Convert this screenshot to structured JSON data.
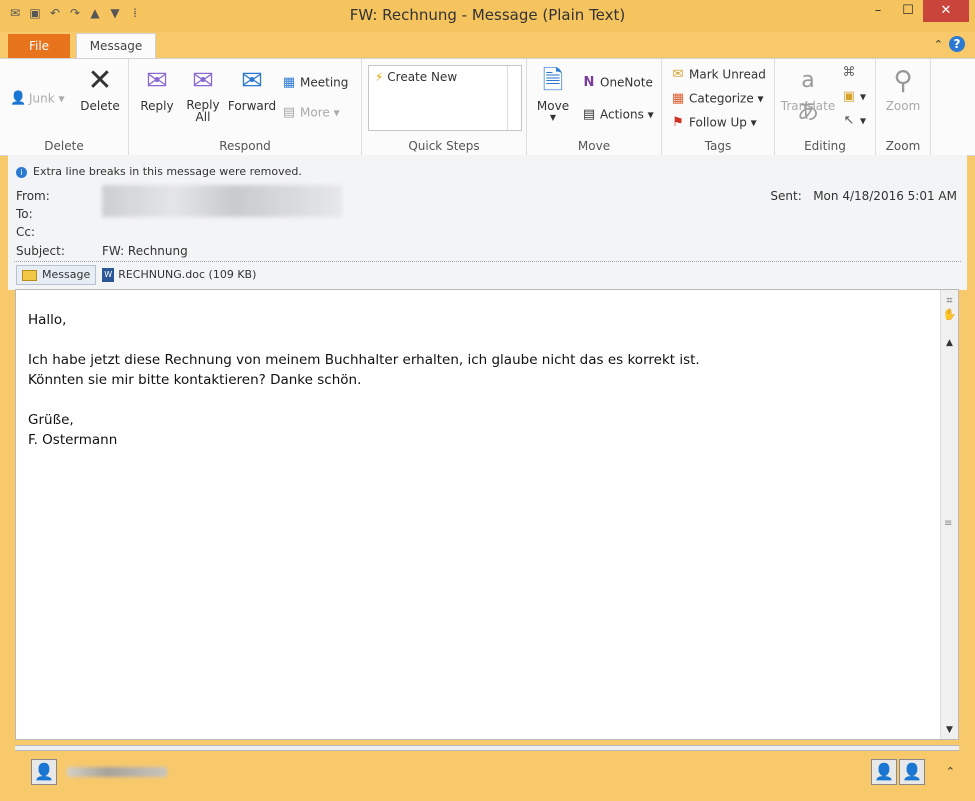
{
  "window": {
    "title": "FW: Rechnung  -  Message (Plain Text)",
    "controls": {
      "minimize": "–",
      "maximize": "☐",
      "close": "✕"
    }
  },
  "quick_access": [
    "mail-icon",
    "save-icon",
    "undo-icon",
    "redo-icon",
    "up-icon",
    "down-icon",
    "customize-icon"
  ],
  "tabs": {
    "file": "File",
    "message": "Message"
  },
  "ribbon": {
    "delete_group": {
      "label": "Delete",
      "junk": "Junk",
      "delete": "Delete"
    },
    "respond_group": {
      "label": "Respond",
      "reply": "Reply",
      "reply_all_1": "Reply",
      "reply_all_2": "All",
      "forward": "Forward",
      "meeting": "Meeting",
      "more": "More"
    },
    "quicksteps_group": {
      "label": "Quick Steps",
      "create_new": "Create New"
    },
    "move_group": {
      "label": "Move",
      "move": "Move",
      "onenote": "OneNote",
      "actions": "Actions"
    },
    "tags_group": {
      "label": "Tags",
      "mark_unread": "Mark Unread",
      "categorize": "Categorize",
      "follow_up": "Follow Up"
    },
    "editing_group": {
      "label": "Editing",
      "translate": "Translate"
    },
    "zoom_group": {
      "label": "Zoom",
      "zoom": "Zoom"
    }
  },
  "header": {
    "info": "Extra line breaks in this message were removed.",
    "from_label": "From:",
    "to_label": "To:",
    "cc_label": "Cc:",
    "subject_label": "Subject:",
    "subject": "FW: Rechnung",
    "sent_label": "Sent:",
    "sent": "Mon 4/18/2016 5:01 AM",
    "message_tab": "Message",
    "attachment": "RECHNUNG.doc (109 KB)"
  },
  "body": {
    "text": "Hallo,\n\nIch habe jetzt diese Rechnung von meinem Buchhalter erhalten, ich glaube nicht das es korrekt ist.\nKönnten sie mir bitte kontaktieren? Danke schön.\n\nGrüße,\nF. Ostermann"
  },
  "colors": {
    "titlebar": "#f5c45f",
    "file_tab": "#e7731d",
    "close": "#c9453b",
    "accent": "#2b79d2"
  }
}
